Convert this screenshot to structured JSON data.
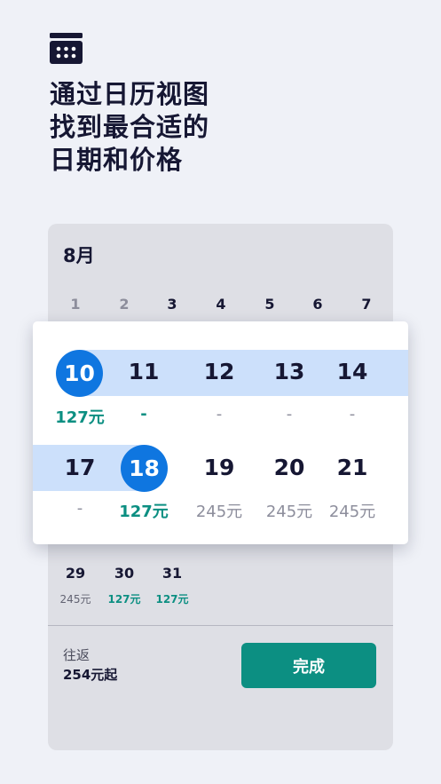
{
  "headline": {
    "line1": "通过日历视图",
    "line2": "找到最合适的",
    "line3": "日期和价格"
  },
  "calendar": {
    "month": "8月",
    "week1": [
      "1",
      "2",
      "3",
      "4",
      "5",
      "6",
      "7"
    ],
    "bottom_row": {
      "days": [
        "29",
        "30",
        "31"
      ],
      "prices": [
        "245元",
        "127元",
        "127元"
      ]
    }
  },
  "popup": {
    "row1": {
      "days": [
        "10",
        "11",
        "12",
        "13",
        "14"
      ],
      "prices": [
        "127元",
        "-",
        "-",
        "-",
        "-"
      ]
    },
    "row2": {
      "days": [
        "17",
        "18",
        "19",
        "20",
        "21"
      ],
      "prices": [
        "-",
        "127元",
        "245元",
        "245元",
        "245元"
      ]
    }
  },
  "footer": {
    "trip_label": "往返",
    "trip_price": "254元起",
    "done_label": "完成"
  },
  "colors": {
    "accent_blue": "#0f76e0",
    "range_band": "#cce0fb",
    "price_green": "#0c8f82",
    "text_dark": "#161733"
  },
  "icons": {
    "header": "calendar-icon"
  }
}
